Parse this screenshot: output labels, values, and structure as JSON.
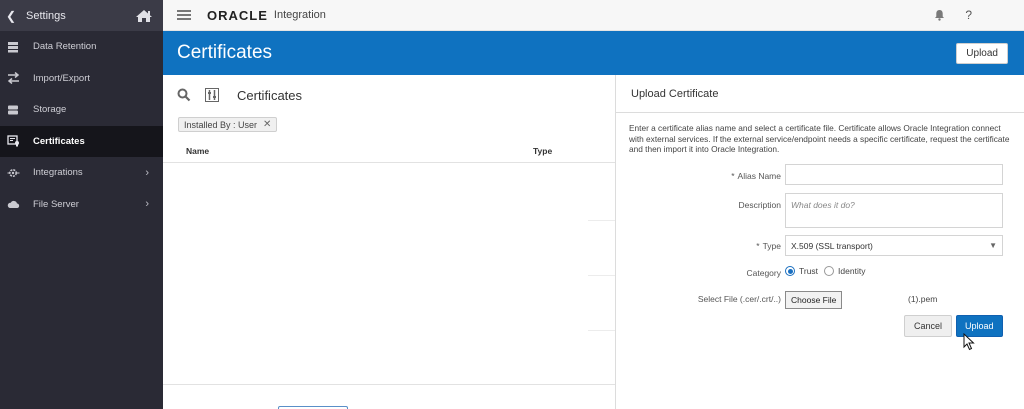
{
  "sidebar": {
    "header": {
      "back_icon": "chevron-left-icon",
      "title": "Settings",
      "home_icon": "home-icon"
    },
    "items": [
      {
        "label": "Data Retention",
        "icon": "database-icon",
        "active": false,
        "has_children": false
      },
      {
        "label": "Import/Export",
        "icon": "transfer-arrows-icon",
        "active": false,
        "has_children": false
      },
      {
        "label": "Storage",
        "icon": "storage-icon",
        "active": false,
        "has_children": false
      },
      {
        "label": "Certificates",
        "icon": "certificate-icon",
        "active": true,
        "has_children": false
      },
      {
        "label": "Integrations",
        "icon": "integrations-gear-icon",
        "active": false,
        "has_children": true
      },
      {
        "label": "File Server",
        "icon": "cloud-icon",
        "active": false,
        "has_children": true
      }
    ]
  },
  "topbar": {
    "brand": "ORACLE",
    "product": "Integration",
    "bell_icon": "notification-bell-icon",
    "help_label": "?"
  },
  "page": {
    "title": "Certificates",
    "upload_label": "Upload"
  },
  "list": {
    "title": "Certificates",
    "search_icon": "search-icon",
    "filter_icon": "filter-panel-icon",
    "filter_chip": "Installed By : User",
    "columns": {
      "name": "Name",
      "type": "Type"
    }
  },
  "upload_panel": {
    "title": "Upload Certificate",
    "description": "Enter a certificate alias name and select a certificate file. Certificate allows Oracle Integration connect with external services. If the external service/endpoint needs a specific certificate, request the certificate and then import it into Oracle Integration.",
    "alias": {
      "label": "Alias Name",
      "value": "",
      "required": true
    },
    "description_field": {
      "label": "Description",
      "placeholder": "What does it do?"
    },
    "type": {
      "label": "Type",
      "value": "X.509 (SSL transport)",
      "required": true
    },
    "category": {
      "label": "Category",
      "options": [
        "Trust",
        "Identity"
      ],
      "selected": "Trust"
    },
    "file": {
      "label": "Select File (.cer/.crt/..)",
      "button": "Choose File",
      "filename": "(1).pem"
    },
    "cancel_label": "Cancel",
    "upload_label": "Upload"
  },
  "colors": {
    "accent": "#0f72c0",
    "sidebar_bg": "#2a2a35",
    "sidebar_active": "#15151b"
  }
}
